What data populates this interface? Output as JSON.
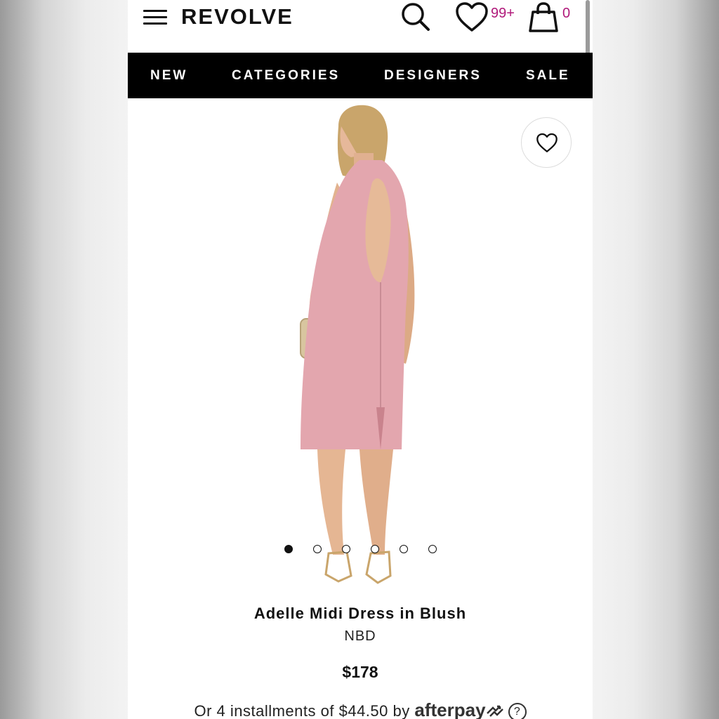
{
  "header": {
    "logo": "REVOLVE",
    "wishlist_count": "99+",
    "cart_count": "0",
    "accent_color": "#b0197a"
  },
  "nav": {
    "items": [
      {
        "label": "NEW"
      },
      {
        "label": "CATEGORIES"
      },
      {
        "label": "DESIGNERS"
      },
      {
        "label": "SALE"
      }
    ]
  },
  "product": {
    "title": "Adelle Midi Dress in Blush",
    "brand": "NBD",
    "price": "$178",
    "image_count": 6,
    "active_image_index": 0,
    "dress_color": "#e3a6ae",
    "installments": {
      "prefix": "Or 4 installments of",
      "amount": "$44.50",
      "by": "by",
      "provider": "afterpay",
      "help": "?"
    }
  },
  "icons": [
    "menu-icon",
    "search-icon",
    "heart-icon",
    "bag-icon",
    "help-icon"
  ]
}
